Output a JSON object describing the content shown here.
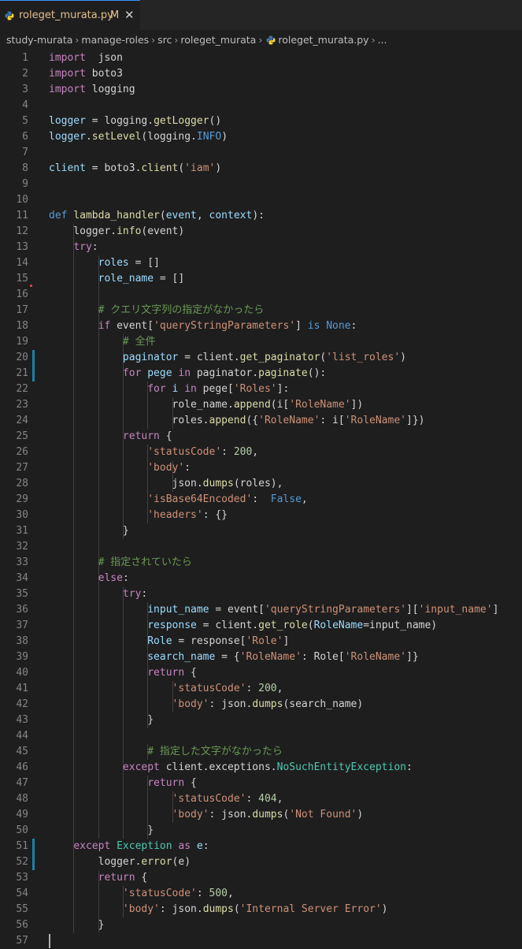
{
  "tab": {
    "filename": "roleget_murata.py",
    "status": "M",
    "close": "✕"
  },
  "breadcrumb": [
    "study-murata",
    "manage-roles",
    "src",
    "roleget_murata",
    "roleget_murata.py",
    "..."
  ],
  "line_numbers": [
    "1",
    "2",
    "3",
    "4",
    "5",
    "6",
    "7",
    "8",
    "9",
    "10",
    "11",
    "12",
    "13",
    "14",
    "15",
    "16",
    "17",
    "18",
    "19",
    "20",
    "21",
    "22",
    "23",
    "24",
    "25",
    "26",
    "27",
    "28",
    "29",
    "30",
    "31",
    "32",
    "33",
    "34",
    "35",
    "36",
    "37",
    "38",
    "39",
    "40",
    "41",
    "42",
    "43",
    "44",
    "45",
    "46",
    "47",
    "48",
    "49",
    "50",
    "51",
    "52",
    "53",
    "54",
    "55",
    "56",
    "57"
  ],
  "code_lines": [
    [
      [
        "kw",
        "import"
      ],
      [
        "",
        "  "
      ],
      [
        "",
        "json"
      ]
    ],
    [
      [
        "kw",
        "import"
      ],
      [
        "",
        " "
      ],
      [
        "",
        "boto3"
      ]
    ],
    [
      [
        "kw",
        "import"
      ],
      [
        "",
        " "
      ],
      [
        "",
        "logging"
      ]
    ],
    [],
    [
      [
        "vr",
        "logger"
      ],
      [
        "",
        " = logging."
      ],
      [
        "fn",
        "getLogger"
      ],
      [
        "",
        "()"
      ]
    ],
    [
      [
        "vr",
        "logger"
      ],
      [
        "",
        "."
      ],
      [
        "fn",
        "setLevel"
      ],
      [
        "",
        "(logging."
      ],
      [
        "bl",
        "INFO"
      ],
      [
        "",
        ")"
      ]
    ],
    [],
    [
      [
        "vr",
        "client"
      ],
      [
        "",
        " = boto3."
      ],
      [
        "fn",
        "client"
      ],
      [
        "",
        "("
      ],
      [
        "st",
        "'iam'"
      ],
      [
        "",
        ")"
      ]
    ],
    [],
    [],
    [
      [
        "bl",
        "def"
      ],
      [
        "",
        " "
      ],
      [
        "fn",
        "lambda_handler"
      ],
      [
        "",
        "("
      ],
      [
        "pm",
        "event"
      ],
      [
        "",
        ", "
      ],
      [
        "pm",
        "context"
      ],
      [
        "",
        "):"
      ]
    ],
    [
      [
        "",
        "    logger."
      ],
      [
        "fn",
        "info"
      ],
      [
        "",
        "(event)"
      ]
    ],
    [
      [
        "",
        "    "
      ],
      [
        "kw",
        "try"
      ],
      [
        "",
        ":"
      ]
    ],
    [
      [
        "",
        "        "
      ],
      [
        "vr",
        "roles"
      ],
      [
        "",
        " = []"
      ]
    ],
    [
      [
        "",
        "        "
      ],
      [
        "vr",
        "role_name"
      ],
      [
        "",
        " = []"
      ]
    ],
    [],
    [
      [
        "",
        "        "
      ],
      [
        "cm",
        "# クエリ文字列の指定がなかったら"
      ]
    ],
    [
      [
        "",
        "        "
      ],
      [
        "kw",
        "if"
      ],
      [
        "",
        " event["
      ],
      [
        "st",
        "'queryStringParameters'"
      ],
      [
        "",
        "] "
      ],
      [
        "bl",
        "is"
      ],
      [
        "",
        " "
      ],
      [
        "bl",
        "None"
      ],
      [
        "",
        ":"
      ]
    ],
    [
      [
        "",
        "            "
      ],
      [
        "cm",
        "# 全件"
      ]
    ],
    [
      [
        "",
        "            "
      ],
      [
        "vr",
        "paginator"
      ],
      [
        "",
        " = client."
      ],
      [
        "fn",
        "get_paginator"
      ],
      [
        "",
        "("
      ],
      [
        "st",
        "'list_roles'"
      ],
      [
        "",
        ")"
      ]
    ],
    [
      [
        "",
        "            "
      ],
      [
        "kw",
        "for"
      ],
      [
        "",
        " "
      ],
      [
        "vr",
        "pege"
      ],
      [
        "",
        " "
      ],
      [
        "kw",
        "in"
      ],
      [
        "",
        " paginator."
      ],
      [
        "fn",
        "paginate"
      ],
      [
        "",
        "():"
      ]
    ],
    [
      [
        "",
        "                "
      ],
      [
        "kw",
        "for"
      ],
      [
        "",
        " "
      ],
      [
        "vr",
        "i"
      ],
      [
        "",
        " "
      ],
      [
        "kw",
        "in"
      ],
      [
        "",
        " pege["
      ],
      [
        "st",
        "'Roles'"
      ],
      [
        "",
        "]:"
      ]
    ],
    [
      [
        "",
        "                    role_name."
      ],
      [
        "fn",
        "append"
      ],
      [
        "",
        "(i["
      ],
      [
        "st",
        "'RoleName'"
      ],
      [
        "",
        "])"
      ]
    ],
    [
      [
        "",
        "                    roles."
      ],
      [
        "fn",
        "append"
      ],
      [
        "",
        "({"
      ],
      [
        "st",
        "'RoleName'"
      ],
      [
        "",
        ": i["
      ],
      [
        "st",
        "'RoleName'"
      ],
      [
        "",
        "]})"
      ]
    ],
    [
      [
        "",
        "            "
      ],
      [
        "kw",
        "return"
      ],
      [
        "",
        " {"
      ]
    ],
    [
      [
        "",
        "                "
      ],
      [
        "st",
        "'statusCode'"
      ],
      [
        "",
        ": "
      ],
      [
        "nm",
        "200"
      ],
      [
        "",
        ","
      ]
    ],
    [
      [
        "",
        "                "
      ],
      [
        "st",
        "'body'"
      ],
      [
        "",
        ":"
      ]
    ],
    [
      [
        "",
        "                    json."
      ],
      [
        "fn",
        "dumps"
      ],
      [
        "",
        "(roles),"
      ]
    ],
    [
      [
        "",
        "                "
      ],
      [
        "st",
        "'isBase64Encoded'"
      ],
      [
        "",
        ":  "
      ],
      [
        "bl",
        "False"
      ],
      [
        "",
        ","
      ]
    ],
    [
      [
        "",
        "                "
      ],
      [
        "st",
        "'headers'"
      ],
      [
        "",
        ": {}"
      ]
    ],
    [
      [
        "",
        "            }"
      ]
    ],
    [],
    [
      [
        "",
        "        "
      ],
      [
        "cm",
        "# 指定されていたら"
      ]
    ],
    [
      [
        "",
        "        "
      ],
      [
        "kw",
        "else"
      ],
      [
        "",
        ":"
      ]
    ],
    [
      [
        "",
        "            "
      ],
      [
        "kw",
        "try"
      ],
      [
        "",
        ":"
      ]
    ],
    [
      [
        "",
        "                "
      ],
      [
        "vr",
        "input_name"
      ],
      [
        "",
        " = event["
      ],
      [
        "st",
        "'queryStringParameters'"
      ],
      [
        "",
        "]["
      ],
      [
        "st",
        "'input_name'"
      ],
      [
        "",
        "]"
      ]
    ],
    [
      [
        "",
        "                "
      ],
      [
        "vr",
        "response"
      ],
      [
        "",
        " = client."
      ],
      [
        "fn",
        "get_role"
      ],
      [
        "",
        "("
      ],
      [
        "pm",
        "RoleName"
      ],
      [
        "",
        "=input_name)"
      ]
    ],
    [
      [
        "",
        "                "
      ],
      [
        "vr",
        "Role"
      ],
      [
        "",
        " = response["
      ],
      [
        "st",
        "'Role'"
      ],
      [
        "",
        "]"
      ]
    ],
    [
      [
        "",
        "                "
      ],
      [
        "vr",
        "search_name"
      ],
      [
        "",
        " = {"
      ],
      [
        "st",
        "'RoleName'"
      ],
      [
        "",
        ": Role["
      ],
      [
        "st",
        "'RoleName'"
      ],
      [
        "",
        "]}"
      ]
    ],
    [
      [
        "",
        "                "
      ],
      [
        "kw",
        "return"
      ],
      [
        "",
        " {"
      ]
    ],
    [
      [
        "",
        "                    "
      ],
      [
        "st",
        "'statusCode'"
      ],
      [
        "",
        ": "
      ],
      [
        "nm",
        "200"
      ],
      [
        "",
        ","
      ]
    ],
    [
      [
        "",
        "                    "
      ],
      [
        "st",
        "'body'"
      ],
      [
        "",
        ": json."
      ],
      [
        "fn",
        "dumps"
      ],
      [
        "",
        "(search_name)"
      ]
    ],
    [
      [
        "",
        "                }"
      ]
    ],
    [],
    [
      [
        "",
        "                "
      ],
      [
        "cm",
        "# 指定した文字がなかったら"
      ]
    ],
    [
      [
        "",
        "            "
      ],
      [
        "kw",
        "except"
      ],
      [
        "",
        " client.exceptions."
      ],
      [
        "cl",
        "NoSuchEntityException"
      ],
      [
        "",
        ":"
      ]
    ],
    [
      [
        "",
        "                "
      ],
      [
        "kw",
        "return"
      ],
      [
        "",
        " {"
      ]
    ],
    [
      [
        "",
        "                    "
      ],
      [
        "st",
        "'statusCode'"
      ],
      [
        "",
        ": "
      ],
      [
        "nm",
        "404"
      ],
      [
        "",
        ","
      ]
    ],
    [
      [
        "",
        "                    "
      ],
      [
        "st",
        "'body'"
      ],
      [
        "",
        ": json."
      ],
      [
        "fn",
        "dumps"
      ],
      [
        "",
        "("
      ],
      [
        "st",
        "'Not Found'"
      ],
      [
        "",
        ")"
      ]
    ],
    [
      [
        "",
        "                }"
      ]
    ],
    [
      [
        "",
        "    "
      ],
      [
        "kw",
        "except"
      ],
      [
        "",
        " "
      ],
      [
        "cl",
        "Exception"
      ],
      [
        "",
        " "
      ],
      [
        "kw",
        "as"
      ],
      [
        "",
        " "
      ],
      [
        "vr",
        "e"
      ],
      [
        "",
        ":"
      ]
    ],
    [
      [
        "",
        "        logger."
      ],
      [
        "fn",
        "error"
      ],
      [
        "",
        "(e)"
      ]
    ],
    [
      [
        "",
        "        "
      ],
      [
        "kw",
        "return"
      ],
      [
        "",
        " {"
      ]
    ],
    [
      [
        "",
        "            "
      ],
      [
        "st",
        "'statusCode'"
      ],
      [
        "",
        ": "
      ],
      [
        "nm",
        "500"
      ],
      [
        "",
        ","
      ]
    ],
    [
      [
        "",
        "            "
      ],
      [
        "st",
        "'body'"
      ],
      [
        "",
        ": json."
      ],
      [
        "fn",
        "dumps"
      ],
      [
        "",
        "("
      ],
      [
        "st",
        "'Internal Server Error'"
      ],
      [
        "",
        ")"
      ]
    ],
    [
      [
        "",
        "        }"
      ]
    ],
    []
  ],
  "icons": {
    "file_icon": "python-file-icon",
    "close_icon": "close-icon",
    "chevron": "chevron-right-icon"
  },
  "colors": {
    "keyword": "#c586c0",
    "builtin": "#569cd6",
    "function": "#dcdcaa",
    "string": "#ce9178",
    "number": "#b5cea8",
    "comment": "#6a9955",
    "class": "#4ec9b0",
    "variable": "#9cdcfe",
    "modified": "#e2c08d"
  }
}
